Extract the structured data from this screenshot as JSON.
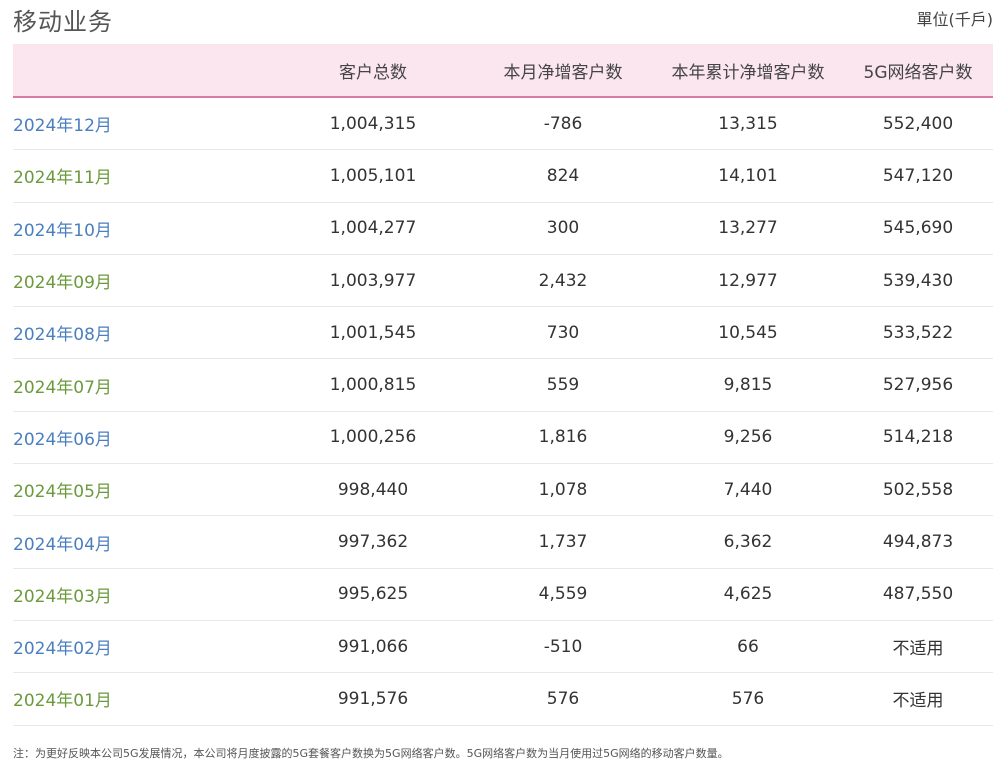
{
  "header": {
    "title": "移动业务",
    "unit": "單位(千戶)"
  },
  "table": {
    "columns": [
      "",
      "客户总数",
      "本月净增客户数",
      "本年累计净增客户数",
      "5G网络客户数"
    ],
    "rows": [
      {
        "month": "2024年12月",
        "total": "1,004,315",
        "monthly_net": "-786",
        "ytd_net": "13,315",
        "five_g": "552,400"
      },
      {
        "month": "2024年11月",
        "total": "1,005,101",
        "monthly_net": "824",
        "ytd_net": "14,101",
        "five_g": "547,120"
      },
      {
        "month": "2024年10月",
        "total": "1,004,277",
        "monthly_net": "300",
        "ytd_net": "13,277",
        "five_g": "545,690"
      },
      {
        "month": "2024年09月",
        "total": "1,003,977",
        "monthly_net": "2,432",
        "ytd_net": "12,977",
        "five_g": "539,430"
      },
      {
        "month": "2024年08月",
        "total": "1,001,545",
        "monthly_net": "730",
        "ytd_net": "10,545",
        "five_g": "533,522"
      },
      {
        "month": "2024年07月",
        "total": "1,000,815",
        "monthly_net": "559",
        "ytd_net": "9,815",
        "five_g": "527,956"
      },
      {
        "month": "2024年06月",
        "total": "1,000,256",
        "monthly_net": "1,816",
        "ytd_net": "9,256",
        "five_g": "514,218"
      },
      {
        "month": "2024年05月",
        "total": "998,440",
        "monthly_net": "1,078",
        "ytd_net": "7,440",
        "five_g": "502,558"
      },
      {
        "month": "2024年04月",
        "total": "997,362",
        "monthly_net": "1,737",
        "ytd_net": "6,362",
        "five_g": "494,873"
      },
      {
        "month": "2024年03月",
        "total": "995,625",
        "monthly_net": "4,559",
        "ytd_net": "4,625",
        "five_g": "487,550"
      },
      {
        "month": "2024年02月",
        "total": "991,066",
        "monthly_net": "-510",
        "ytd_net": "66",
        "five_g": "不适用"
      },
      {
        "month": "2024年01月",
        "total": "991,576",
        "monthly_net": "576",
        "ytd_net": "576",
        "five_g": "不适用"
      }
    ]
  },
  "colors": {
    "header_bg": "#fbe6f0",
    "header_border": "#d97aa8",
    "month_blue": "#4a7fbf",
    "month_green": "#6b9a3c"
  },
  "footnote": "注：为更好反映本公司5G发展情况，本公司将月度披露的5G套餐客户数换为5G网络客户数。5G网络客户数为当月使用过5G网络的移动客户数量。"
}
